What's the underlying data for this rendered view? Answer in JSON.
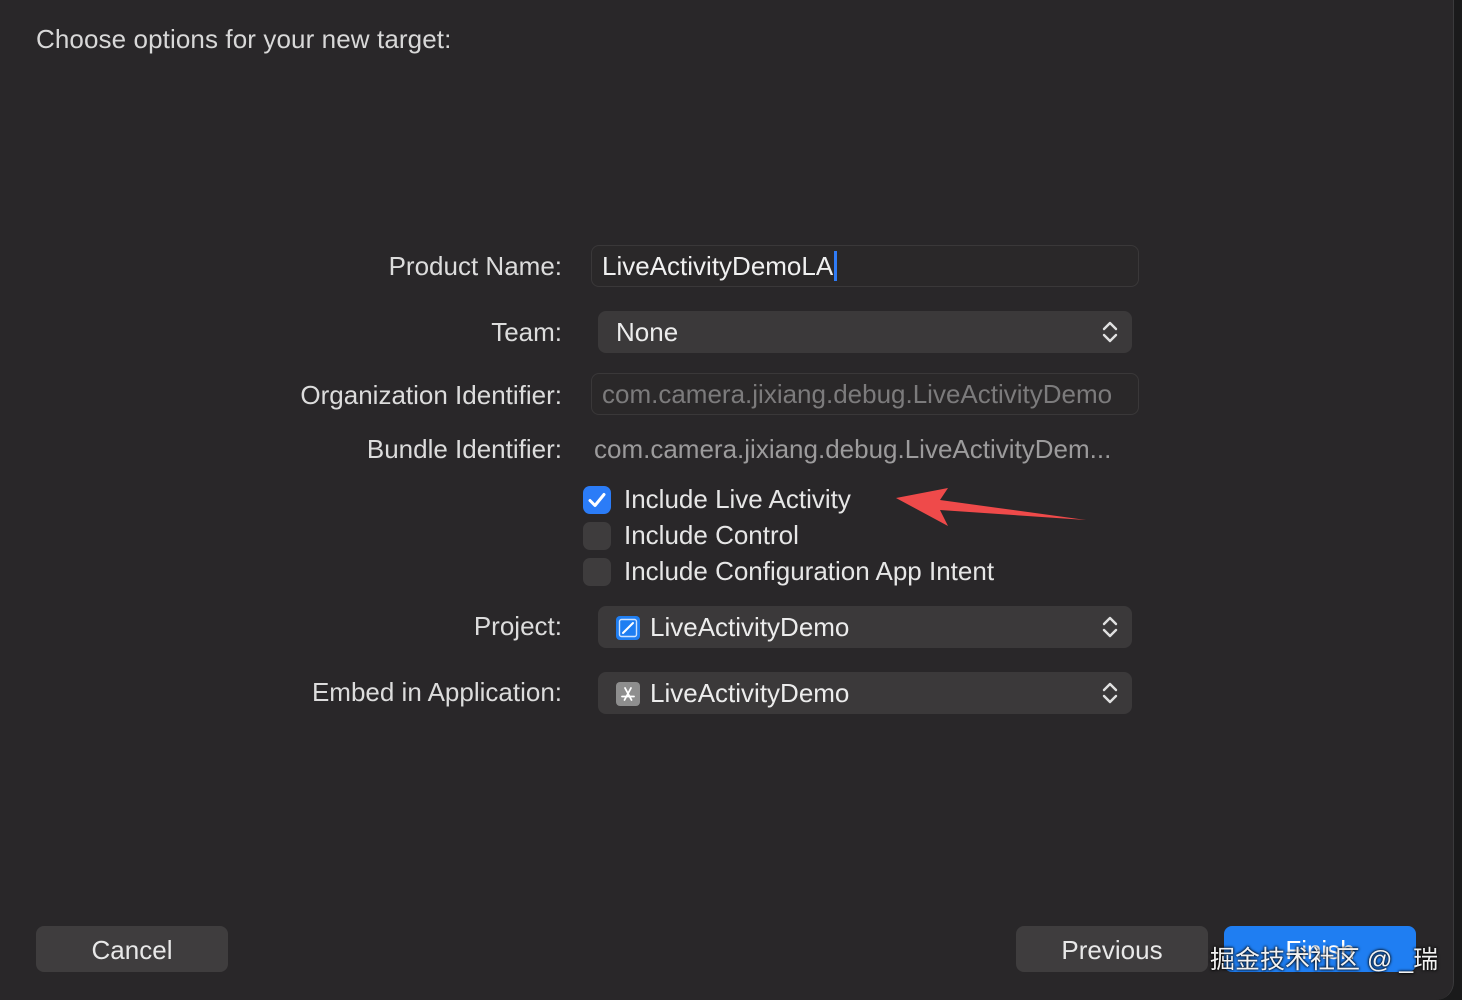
{
  "dialog": {
    "title": "Choose options for your new target:"
  },
  "form": {
    "product_name": {
      "label": "Product Name:",
      "value": "LiveActivityDemoLA"
    },
    "team": {
      "label": "Team:",
      "value": "None"
    },
    "organization_identifier": {
      "label": "Organization Identifier:",
      "placeholder": "com.camera.jixiang.debug.LiveActivityDemo"
    },
    "bundle_identifier": {
      "label": "Bundle Identifier:",
      "value": "com.camera.jixiang.debug.LiveActivityDem..."
    },
    "options": [
      {
        "label": "Include Live Activity",
        "checked": true
      },
      {
        "label": "Include Control",
        "checked": false
      },
      {
        "label": "Include Configuration App Intent",
        "checked": false
      }
    ],
    "project": {
      "label": "Project:",
      "value": "LiveActivityDemo",
      "icon": "xcode-project-icon"
    },
    "embed_in_application": {
      "label": "Embed in Application:",
      "value": "LiveActivityDemo",
      "icon": "app-store-icon"
    }
  },
  "buttons": {
    "cancel": "Cancel",
    "previous": "Previous",
    "finish": "Finish"
  },
  "annotation": {
    "arrow_color": "#ef4a4a"
  },
  "watermark": {
    "text": "掘金技术社区 @ _瑞"
  },
  "colors": {
    "accent": "#1f7ef2",
    "background": "#292729"
  }
}
